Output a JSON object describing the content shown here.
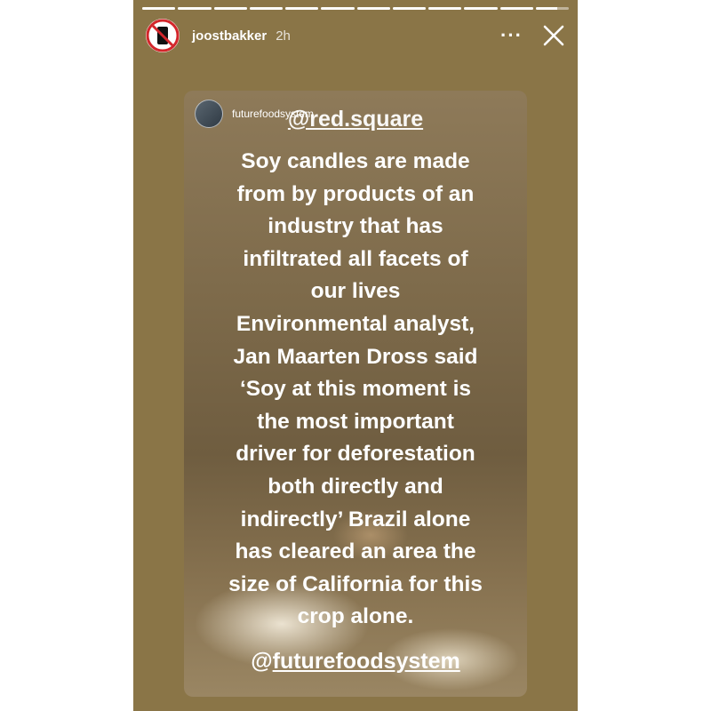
{
  "story": {
    "username": "joostbakker",
    "time": "2h",
    "more_icon": "···",
    "progress_fraction": 0.97,
    "segments_total": 12,
    "segments_done": 11
  },
  "card": {
    "username": "futurefoodsystem",
    "mention_top": "@red.square",
    "body": "Soy candles are made\nfrom by products of an\nindustry that has\ninfiltrated all facets of\nour lives\nEnvironmental analyst,\nJan Maarten Dross said\n‘Soy at this moment is\nthe most important\ndriver for deforestation\nboth directly and\nindirectly’ Brazil alone\nhas cleared an area the\nsize of California for this\ncrop alone.",
    "mention_bottom_at": "@",
    "mention_bottom_name": "futurefoodsystem"
  },
  "colors": {
    "story_bg": "#8a7547",
    "text": "#ffffff",
    "avatar_red": "#d3262b"
  }
}
